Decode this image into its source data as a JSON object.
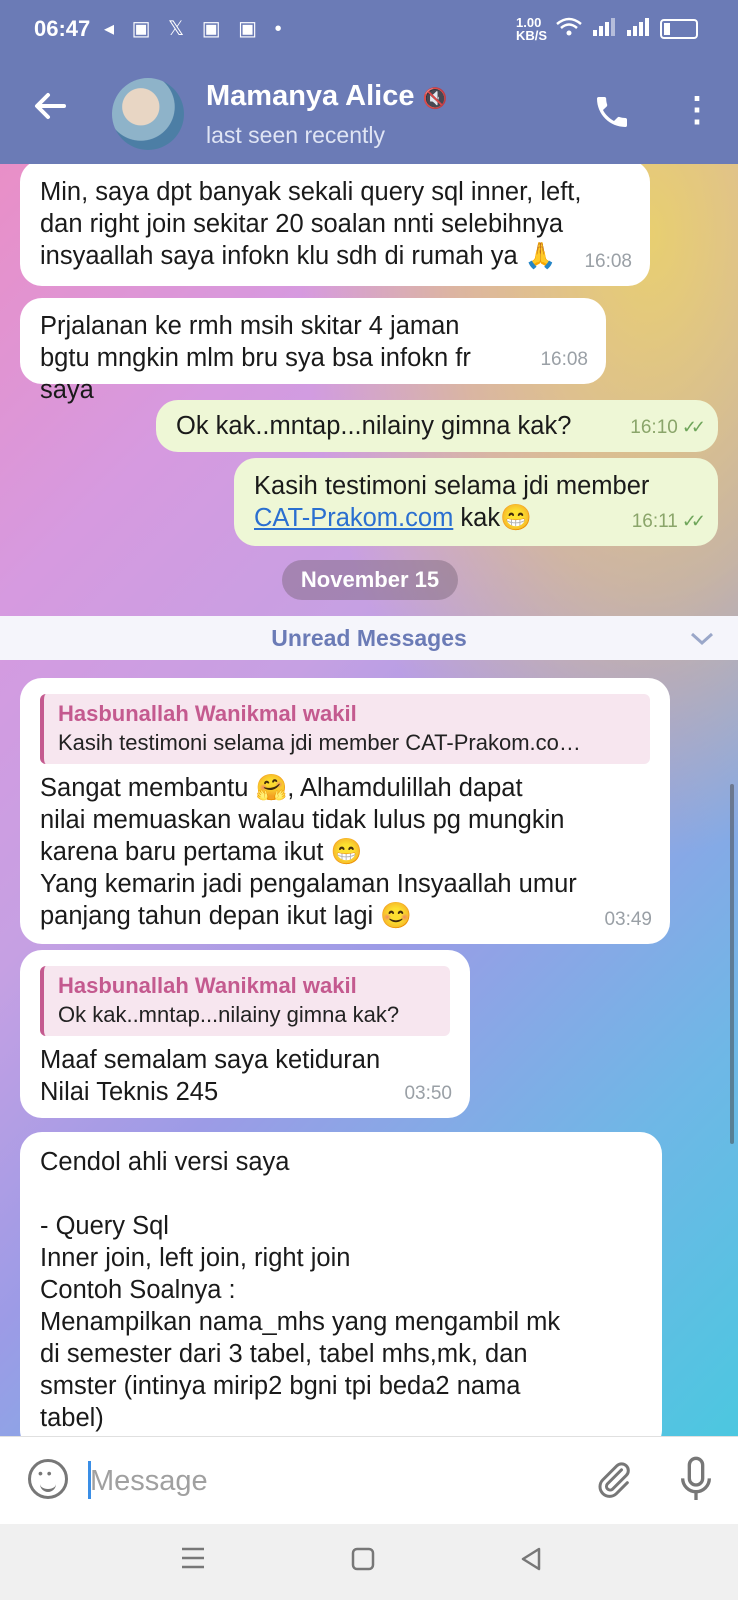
{
  "status": {
    "time": "06:47",
    "net_speed": "1.00 KB/S",
    "status_icons": "◂ ▣ 𝕏 ▣ ▣ •"
  },
  "header": {
    "name": "Mamanya Alice",
    "last_seen": "last seen recently",
    "mute_icon": "🔇"
  },
  "messages": [
    {
      "type": "incoming",
      "text": "Min, saya dpt banyak sekali query sql inner, left, dan right join sekitar 20 soalan nnti selebihnya insyaallah saya infokn klu sdh di rumah ya 🙏",
      "time": "16:08"
    },
    {
      "type": "incoming",
      "text": "Prjalanan ke rmh msih skitar 4 jaman bgtu mngkin mlm bru sya bsa infokn fr saya",
      "time": "16:08"
    },
    {
      "type": "outgoing",
      "text": "Ok kak..mntap...nilainy gimna kak?",
      "time": "16:10"
    },
    {
      "type": "outgoing",
      "text_before": "Kasih testimoni selama jdi member",
      "link": "CAT-Prakom.com",
      "text_after": " kak😁",
      "time": "16:11"
    }
  ],
  "date_divider": "November 15",
  "unread_label": "Unread Messages",
  "replies": [
    {
      "reply_name": "Hasbunallah Wanikmal wakil",
      "reply_text": "Kasih testimoni selama jdi member CAT-Prakom.co…",
      "lines": [
        "Sangat membantu 🤗, Alhamdulillah dapat",
        "nilai memuaskan walau tidak lulus pg mungkin",
        "karena baru pertama ikut 😁",
        "Yang kemarin jadi pengalaman Insyaallah umur",
        "panjang tahun depan ikut lagi 😊"
      ],
      "time": "03:49"
    },
    {
      "reply_name": "Hasbunallah Wanikmal wakil",
      "reply_text": "Ok kak..mntap...nilainy gimna kak?",
      "lines": [
        "Maaf semalam saya ketiduran",
        "Nilai Teknis 245"
      ],
      "time": "03:50"
    }
  ],
  "long_message": {
    "lines": [
      "Cendol ahli versi saya",
      "",
      "- Query Sql",
      "Inner join, left join, right join",
      "Contoh Soalnya :",
      "Menampilkan nama_mhs yang mengambil mk",
      "di semester dari 3 tabel, tabel mhs,mk, dan",
      "smster (intinya mirip2 bgni tpi beda2 nama",
      "tabel)"
    ]
  },
  "composer": {
    "placeholder": "Message"
  },
  "colors": {
    "header": "#6b7bb6",
    "outgoing": "#eef7d6",
    "incoming": "#ffffff",
    "reply_accent": "#c45a8f"
  }
}
